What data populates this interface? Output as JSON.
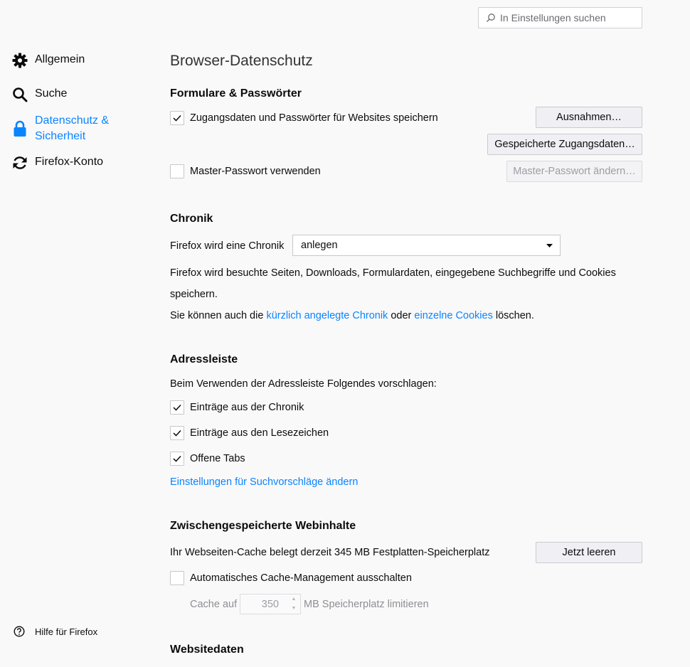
{
  "search": {
    "placeholder": "In Einstellungen suchen"
  },
  "sidebar": {
    "items": [
      {
        "label": "Allgemein",
        "icon": "gear-icon"
      },
      {
        "label": "Suche",
        "icon": "search-icon"
      },
      {
        "label": "Datenschutz & Sicherheit",
        "label_line1": "Datenschutz &",
        "label_line2": "Sicherheit",
        "icon": "lock-icon",
        "selected": true
      },
      {
        "label": "Firefox-Konto",
        "icon": "sync-icon"
      }
    ],
    "help": {
      "label": "Hilfe für Firefox",
      "icon": "help-icon"
    }
  },
  "colors": {
    "accent": "#0a84ff",
    "background": "#f9f9fa",
    "text": "#0c0c0d"
  },
  "page_title": "Browser-Datenschutz",
  "forms": {
    "title": "Formulare & Passwörter",
    "save_logins": {
      "label": "Zugangsdaten und Passwörter für Websites speichern",
      "checked": true
    },
    "exceptions_button": "Ausnahmen…",
    "saved_logins_button": "Gespeicherte Zugangsdaten…",
    "master_password": {
      "label": "Master-Passwort verwenden",
      "checked": false
    },
    "change_master_button": "Master-Passwort ändern…"
  },
  "history": {
    "title": "Chronik",
    "mode_label": "Firefox wird eine Chronik",
    "mode_value": "anlegen",
    "desc_line1": "Firefox wird besuchte Seiten, Downloads, Formulardaten, eingegebene Suchbegriffe und Cookies",
    "desc_line2": "speichern.",
    "clear_prefix": "Sie können auch die ",
    "clear_link1": "kürzlich angelegte Chronik",
    "clear_mid": " oder ",
    "clear_link2": "einzelne Cookies",
    "clear_suffix": " löschen."
  },
  "addressbar": {
    "title": "Adressleiste",
    "intro": "Beim Verwenden der Adressleiste Folgendes vorschlagen:",
    "options": [
      {
        "label": "Einträge aus der Chronik",
        "checked": true
      },
      {
        "label": "Einträge aus den Lesezeichen",
        "checked": true
      },
      {
        "label": "Offene Tabs",
        "checked": true
      }
    ],
    "suggest_link": "Einstellungen für Suchvorschläge ändern"
  },
  "cache": {
    "title": "Zwischengespeicherte Webinhalte",
    "usage": "Ihr Webseiten-Cache belegt derzeit 345 MB Festplatten-Speicherplatz",
    "clear_button": "Jetzt leeren",
    "override": {
      "label": "Automatisches Cache-Management ausschalten",
      "checked": false
    },
    "limit_prefix": "Cache auf",
    "limit_value": "350",
    "limit_suffix": "MB Speicherplatz limitieren"
  },
  "sitedata": {
    "title": "Websitedaten"
  }
}
